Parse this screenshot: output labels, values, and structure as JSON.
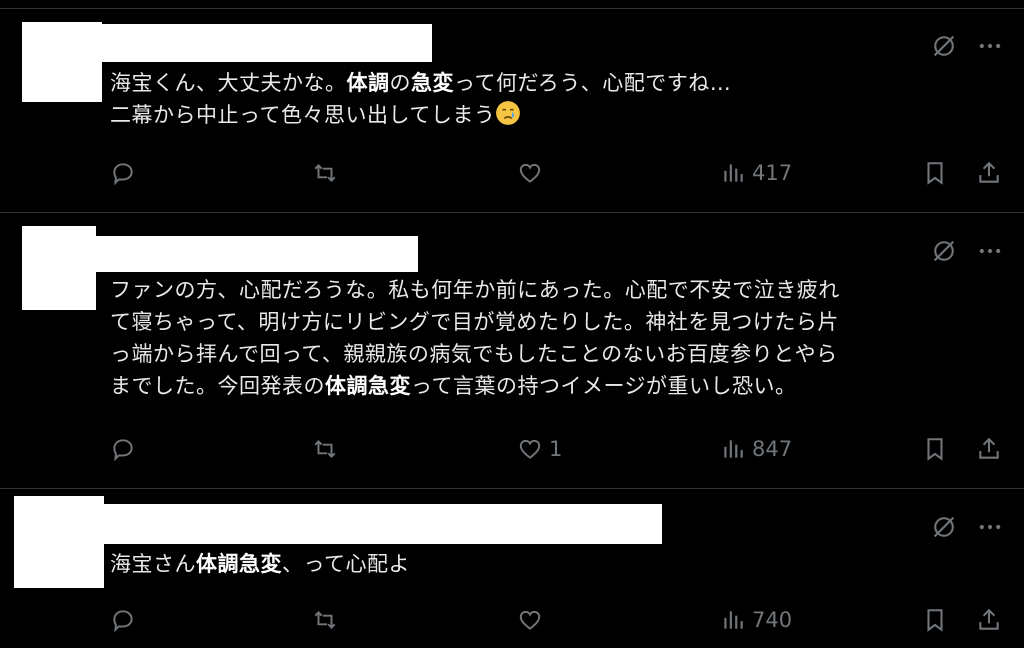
{
  "tweets": [
    {
      "lines": [
        [
          "海宝くん、大丈夫かな。",
          {
            "b": "体調"
          },
          "の",
          {
            "b": "急変"
          },
          "って何だろう、心配ですね…"
        ],
        [
          "二幕から中止って色々思い出してしまう",
          {
            "emoji": "crying-face"
          }
        ]
      ],
      "reply_count": "",
      "retweet_count": "",
      "like_count": "",
      "view_count": "417"
    },
    {
      "lines": [
        [
          "ファンの方、心配だろうな。私も何年か前にあった。心配で不安で泣き疲れ"
        ],
        [
          "て寝ちゃって、明け方にリビングで目が覚めたりした。神社を見つけたら片"
        ],
        [
          "っ端から拝んで回って、親親族の病気でもしたことのないお百度参りとやら"
        ],
        [
          "までした。今回発表の",
          {
            "b": "体調急変"
          },
          "って言葉の持つイメージが重いし恐い。"
        ]
      ],
      "reply_count": "",
      "retweet_count": "",
      "like_count": "1",
      "view_count": "847"
    },
    {
      "lines": [
        [
          "海宝さん",
          {
            "b": "体調急変"
          },
          "、って心配よ"
        ]
      ],
      "reply_count": "",
      "retweet_count": "",
      "like_count": "",
      "view_count": "740"
    }
  ],
  "colors": {
    "background": "#000000",
    "text": "#e7e9ea",
    "muted": "#71767b",
    "divider": "#2f3336"
  },
  "icons": [
    "grok-icon",
    "more-icon",
    "reply-icon",
    "retweet-icon",
    "like-icon",
    "views-icon",
    "bookmark-icon",
    "share-icon"
  ]
}
